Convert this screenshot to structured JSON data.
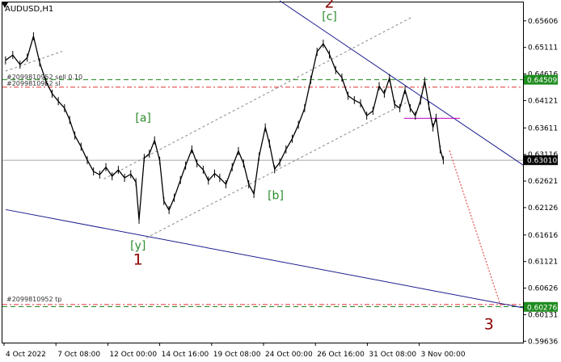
{
  "header": {
    "symbol": "AUDUSD,H1"
  },
  "chart_data": {
    "type": "line",
    "symbol": "AUDUSD",
    "timeframe": "H1",
    "x_ticks": [
      "4 Oct 2022",
      "7 Oct 08:00",
      "12 Oct 00:00",
      "14 Oct 16:00",
      "19 Oct 08:00",
      "24 Oct 00:00",
      "26 Oct 16:00",
      "31 Oct 08:00",
      "3 Nov 00:00"
    ],
    "y_ticks": [
      0.65606,
      0.65111,
      0.64616,
      0.64121,
      0.63611,
      0.63116,
      0.62621,
      0.62126,
      0.61616,
      0.61121,
      0.60626,
      0.60131,
      0.59636
    ],
    "y_range": [
      0.5961,
      0.6595
    ],
    "price_tags": [
      {
        "value": 0.64509,
        "text": "0.64509",
        "bg": "#1e8c1e",
        "fg": "#ffffff"
      },
      {
        "value": 0.6301,
        "text": "0.63010",
        "bg": "#000000",
        "fg": "#ffffff"
      },
      {
        "value": 0.60276,
        "text": "0.60276",
        "bg": "#1e8c1e",
        "fg": "#ffffff"
      }
    ],
    "order_labels": [
      {
        "text": "#2099810952 sell 0.10",
        "value": 0.6449
      },
      {
        "text": "#2099810952 sl",
        "value": 0.6437
      },
      {
        "text": "#2099810952 tp",
        "value": 0.6035
      }
    ],
    "wave_labels": [
      {
        "text": "2",
        "x": 31.6,
        "y": 0.6585,
        "color": "#8b0000",
        "size": 19
      },
      {
        "text": "[c]",
        "x": 31.6,
        "y": 0.6562,
        "color": "#2e8b2e",
        "size": 14
      },
      {
        "text": "[a]",
        "x": 13.6,
        "y": 0.6373,
        "color": "#2e8b2e",
        "size": 14
      },
      {
        "text": "[b]",
        "x": 26.4,
        "y": 0.6228,
        "color": "#2e8b2e",
        "size": 14
      },
      {
        "text": "[y]",
        "x": 13.1,
        "y": 0.6135,
        "color": "#2e8b2e",
        "size": 14
      },
      {
        "text": "1",
        "x": 13.1,
        "y": 0.6106,
        "color": "#8b0000",
        "size": 19
      },
      {
        "text": "3",
        "x": 47.0,
        "y": 0.5986,
        "color": "#8b0000",
        "size": 19
      }
    ],
    "x_range": [
      0,
      50.3
    ],
    "series": [
      {
        "values": [
          [
            0.3,
            0.6487
          ],
          [
            1.0,
            0.6497
          ],
          [
            1.7,
            0.6479
          ],
          [
            2.4,
            0.6492
          ],
          [
            3.0,
            0.6532
          ],
          [
            3.6,
            0.6483
          ],
          [
            4.2,
            0.6448
          ],
          [
            4.8,
            0.6425
          ],
          [
            5.4,
            0.6411
          ],
          [
            6.0,
            0.6398
          ],
          [
            6.5,
            0.6376
          ],
          [
            7.0,
            0.6347
          ],
          [
            7.6,
            0.6326
          ],
          [
            8.2,
            0.6301
          ],
          [
            8.8,
            0.628
          ],
          [
            9.4,
            0.6274
          ],
          [
            10.0,
            0.6288
          ],
          [
            10.6,
            0.6271
          ],
          [
            11.2,
            0.6283
          ],
          [
            11.8,
            0.6268
          ],
          [
            12.4,
            0.6275
          ],
          [
            12.9,
            0.626
          ],
          [
            13.2,
            0.619
          ],
          [
            13.7,
            0.6305
          ],
          [
            14.2,
            0.6313
          ],
          [
            14.7,
            0.6338
          ],
          [
            15.2,
            0.63
          ],
          [
            15.6,
            0.6225
          ],
          [
            16.1,
            0.6208
          ],
          [
            16.6,
            0.6231
          ],
          [
            17.2,
            0.6264
          ],
          [
            17.7,
            0.6291
          ],
          [
            18.3,
            0.6321
          ],
          [
            18.8,
            0.6295
          ],
          [
            19.4,
            0.6283
          ],
          [
            19.9,
            0.6263
          ],
          [
            20.5,
            0.6276
          ],
          [
            21.0,
            0.6268
          ],
          [
            21.6,
            0.6256
          ],
          [
            22.2,
            0.6288
          ],
          [
            22.8,
            0.6318
          ],
          [
            23.3,
            0.6295
          ],
          [
            23.8,
            0.6256
          ],
          [
            24.3,
            0.6238
          ],
          [
            24.8,
            0.6308
          ],
          [
            25.4,
            0.6362
          ],
          [
            25.8,
            0.6332
          ],
          [
            26.3,
            0.6284
          ],
          [
            26.8,
            0.6297
          ],
          [
            27.4,
            0.6321
          ],
          [
            28.0,
            0.6341
          ],
          [
            28.6,
            0.6367
          ],
          [
            29.2,
            0.6398
          ],
          [
            29.8,
            0.6451
          ],
          [
            30.4,
            0.6503
          ],
          [
            31.0,
            0.6518
          ],
          [
            31.6,
            0.6498
          ],
          [
            32.2,
            0.6469
          ],
          [
            32.8,
            0.6455
          ],
          [
            33.4,
            0.6421
          ],
          [
            34.0,
            0.6413
          ],
          [
            34.6,
            0.6407
          ],
          [
            35.2,
            0.6384
          ],
          [
            35.8,
            0.6393
          ],
          [
            36.4,
            0.6439
          ],
          [
            36.9,
            0.6425
          ],
          [
            37.4,
            0.6454
          ],
          [
            37.9,
            0.6405
          ],
          [
            38.4,
            0.6398
          ],
          [
            38.9,
            0.6432
          ],
          [
            39.4,
            0.6398
          ],
          [
            39.9,
            0.6384
          ],
          [
            40.4,
            0.6412
          ],
          [
            40.8,
            0.6448
          ],
          [
            41.2,
            0.6402
          ],
          [
            41.6,
            0.6362
          ],
          [
            41.9,
            0.638
          ],
          [
            42.3,
            0.6321
          ],
          [
            42.6,
            0.6301
          ]
        ]
      }
    ],
    "lines": [
      {
        "from": [
          26.8,
          0.6598
        ],
        "to": [
          50.3,
          0.6292
        ],
        "color": "#1c1c8f"
      },
      {
        "from": [
          0.3,
          0.6209
        ],
        "to": [
          50.3,
          0.6026
        ],
        "color": "#1c1c8f"
      },
      {
        "from": [
          9.8,
          0.6266
        ],
        "to": [
          39.5,
          0.6567
        ],
        "color": "#888888",
        "dash": "3,3"
      },
      {
        "from": [
          13.9,
          0.6156
        ],
        "to": [
          39.0,
          0.6408
        ],
        "color": "#888888",
        "dash": "3,3"
      },
      {
        "from": [
          0.3,
          0.6467
        ],
        "to": [
          5.8,
          0.6504
        ],
        "color": "#888888",
        "dash": "3,3"
      },
      {
        "from": [
          43.2,
          0.6319
        ],
        "to": [
          48.2,
          0.6026
        ],
        "color": "#e03030",
        "dash": "2,2"
      },
      {
        "from": [
          38.8,
          0.6379
        ],
        "to": [
          44.2,
          0.6379
        ],
        "color": "#c000c0"
      }
    ],
    "hlines": [
      {
        "value": 0.6451,
        "color": "#1e8c1e",
        "dash": "6,4"
      },
      {
        "value": 0.6437,
        "color": "#e03030",
        "dash": "6,3,2,3"
      },
      {
        "value": 0.6301,
        "color": "#aaaaaa",
        "dash": ""
      },
      {
        "value": 0.6032,
        "color": "#e03030",
        "dash": "6,3,2,3"
      },
      {
        "value": 0.6028,
        "color": "#1e8c1e",
        "dash": "6,4"
      }
    ]
  }
}
